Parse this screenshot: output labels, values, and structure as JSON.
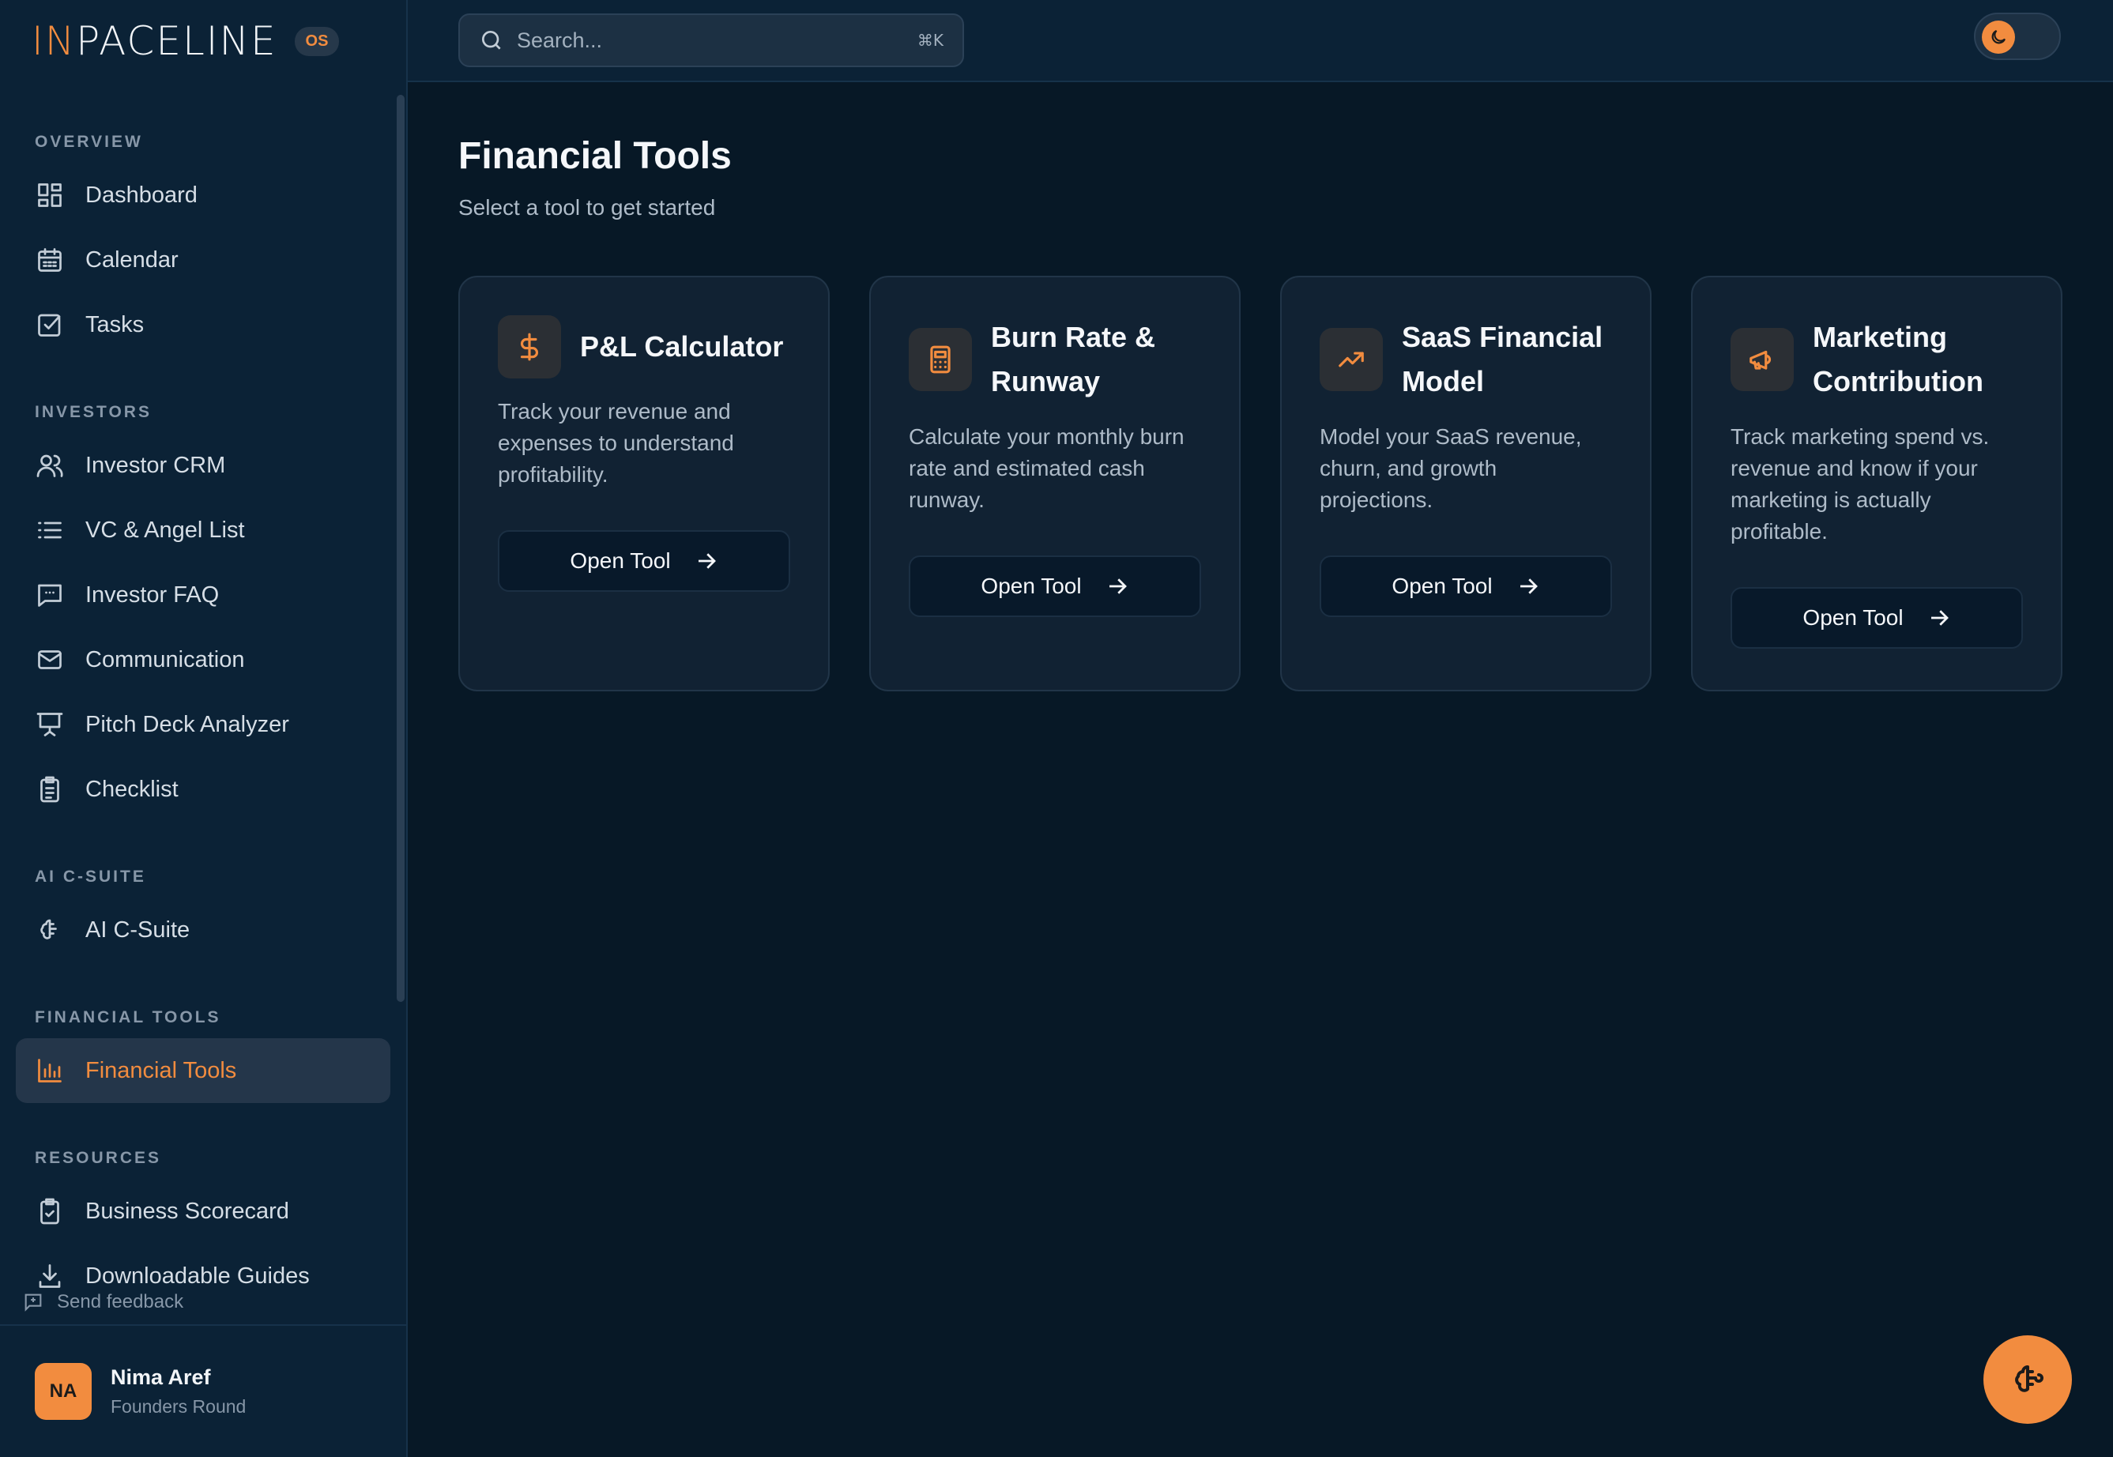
{
  "brand": {
    "logo_in": "IN",
    "logo_rest": "PACELINE",
    "badge": "OS",
    "accent": "#f28c3f"
  },
  "sidebar": {
    "sections": [
      {
        "title": "OVERVIEW",
        "items": [
          {
            "label": "Dashboard",
            "icon": "dashboard-icon"
          },
          {
            "label": "Calendar",
            "icon": "calendar-icon"
          },
          {
            "label": "Tasks",
            "icon": "tasks-icon"
          }
        ]
      },
      {
        "title": "INVESTORS",
        "items": [
          {
            "label": "Investor CRM",
            "icon": "users-icon"
          },
          {
            "label": "VC & Angel List",
            "icon": "list-icon"
          },
          {
            "label": "Investor FAQ",
            "icon": "message-icon"
          },
          {
            "label": "Communication",
            "icon": "mail-icon"
          },
          {
            "label": "Pitch Deck Analyzer",
            "icon": "presentation-icon"
          },
          {
            "label": "Checklist",
            "icon": "clipboard-icon"
          }
        ]
      },
      {
        "title": "AI C-SUITE",
        "items": [
          {
            "label": "AI C-Suite",
            "icon": "brain-icon"
          }
        ]
      },
      {
        "title": "FINANCIAL TOOLS",
        "items": [
          {
            "label": "Financial Tools",
            "icon": "bar-chart-icon",
            "active": true
          }
        ]
      },
      {
        "title": "RESOURCES",
        "items": [
          {
            "label": "Business Scorecard",
            "icon": "clipboard-check-icon"
          },
          {
            "label": "Downloadable Guides",
            "icon": "download-icon"
          }
        ]
      }
    ],
    "feedback": "Send feedback",
    "user": {
      "initials": "NA",
      "name": "Nima Aref",
      "plan": "Founders Round"
    }
  },
  "topbar": {
    "search_placeholder": "Search...",
    "shortcut": "⌘K"
  },
  "main": {
    "title": "Financial Tools",
    "subtitle": "Select a tool to get started",
    "cards": [
      {
        "title": "P&L Calculator",
        "icon": "dollar-icon",
        "desc": "Track your revenue and expenses to understand profitability.",
        "button": "Open Tool"
      },
      {
        "title": "Burn Rate & Runway",
        "icon": "calculator-icon",
        "desc": "Calculate your monthly burn rate and estimated cash runway.",
        "button": "Open Tool"
      },
      {
        "title": "SaaS Financial Model",
        "icon": "trending-up-icon",
        "desc": "Model your SaaS revenue, churn, and growth projections.",
        "button": "Open Tool"
      },
      {
        "title": "Marketing Contribution",
        "icon": "megaphone-icon",
        "desc": "Track marketing spend vs. revenue and know if your marketing is actually profitable.",
        "button": "Open Tool"
      }
    ]
  }
}
